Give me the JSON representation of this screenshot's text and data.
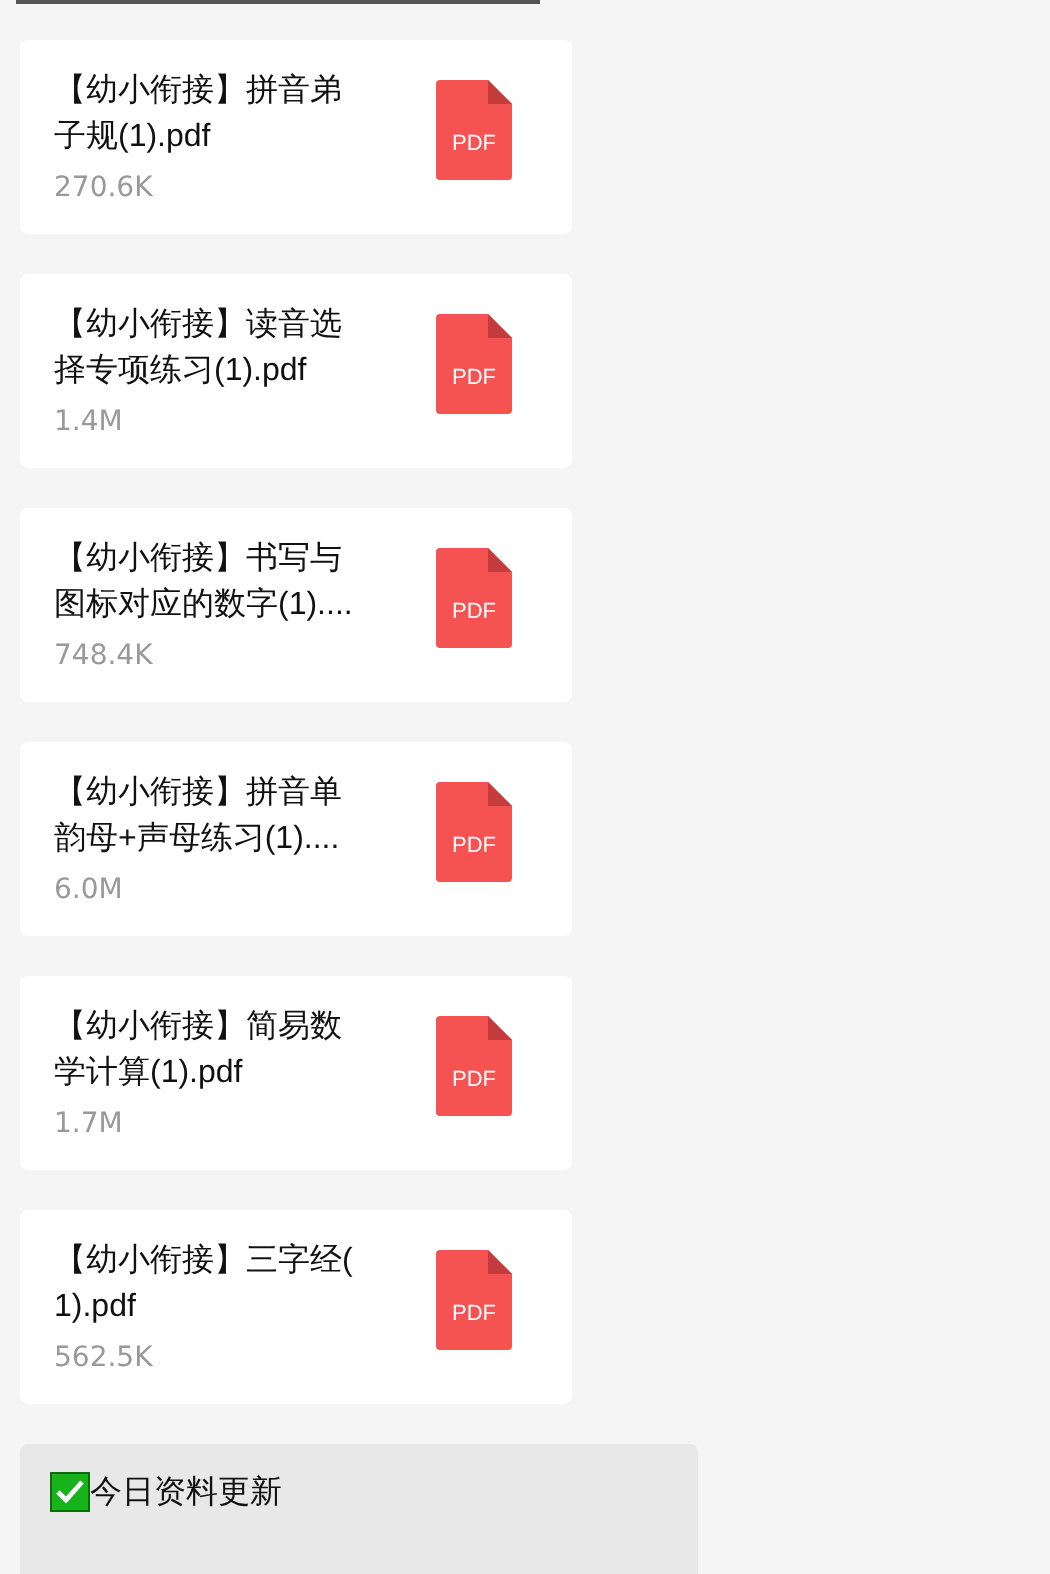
{
  "files": [
    {
      "name": "【幼小衔接】拼音弟子规(1).pdf",
      "size": "270.6K",
      "type": "PDF"
    },
    {
      "name": "【幼小衔接】读音选择专项练习(1).pdf",
      "size": "1.4M",
      "type": "PDF"
    },
    {
      "name": "【幼小衔接】书写与图标对应的数字(1)....",
      "size": "748.4K",
      "type": "PDF"
    },
    {
      "name": "【幼小衔接】拼音单韵母+声母练习(1)....",
      "size": "6.0M",
      "type": "PDF"
    },
    {
      "name": "【幼小衔接】简易数学计算(1).pdf",
      "size": "1.7M",
      "type": "PDF"
    },
    {
      "name": "【幼小衔接】三字经(1).pdf",
      "size": "562.5K",
      "type": "PDF"
    }
  ],
  "message": {
    "lines": [
      {
        "kind": "check",
        "text": "今日资料更新"
      }
    ]
  }
}
